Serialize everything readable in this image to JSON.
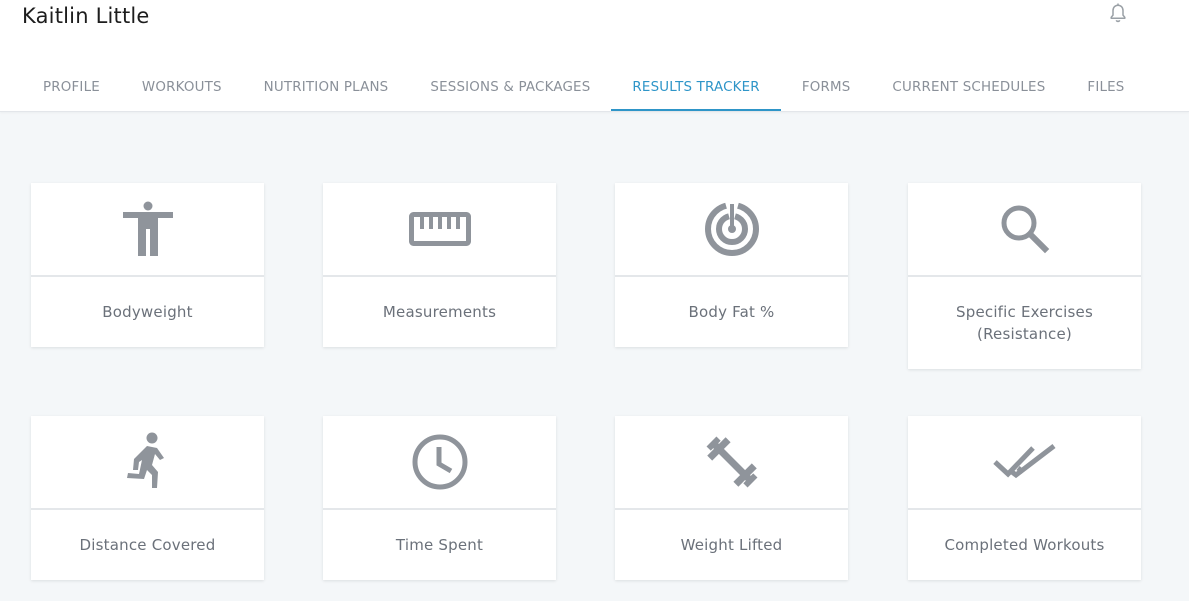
{
  "client": {
    "name": "Kaitlin Little"
  },
  "header": {
    "notification_icon": "bell-icon"
  },
  "tabs": [
    {
      "label": "PROFILE"
    },
    {
      "label": "WORKOUTS"
    },
    {
      "label": "NUTRITION PLANS"
    },
    {
      "label": "SESSIONS & PACKAGES"
    },
    {
      "label": "RESULTS TRACKER"
    },
    {
      "label": "FORMS"
    },
    {
      "label": "CURRENT SCHEDULES"
    },
    {
      "label": "FILES"
    }
  ],
  "active_tab": "RESULTS TRACKER",
  "trackers": [
    {
      "label": "Bodyweight",
      "icon": "person-standing-icon"
    },
    {
      "label": "Measurements",
      "icon": "ruler-icon"
    },
    {
      "label": "Body Fat %",
      "icon": "target-icon"
    },
    {
      "label": "Specific Exercises\n(Resistance)",
      "icon": "search-icon"
    },
    {
      "label": "Distance Covered",
      "icon": "running-icon"
    },
    {
      "label": "Time Spent",
      "icon": "clock-icon"
    },
    {
      "label": "Weight Lifted",
      "icon": "dumbbell-icon"
    },
    {
      "label": "Completed Workouts",
      "icon": "double-check-icon"
    }
  ],
  "colors": {
    "accent": "#2e95c8",
    "icon": "#8f949b",
    "label": "#6b717a",
    "background": "#f4f7f9"
  }
}
